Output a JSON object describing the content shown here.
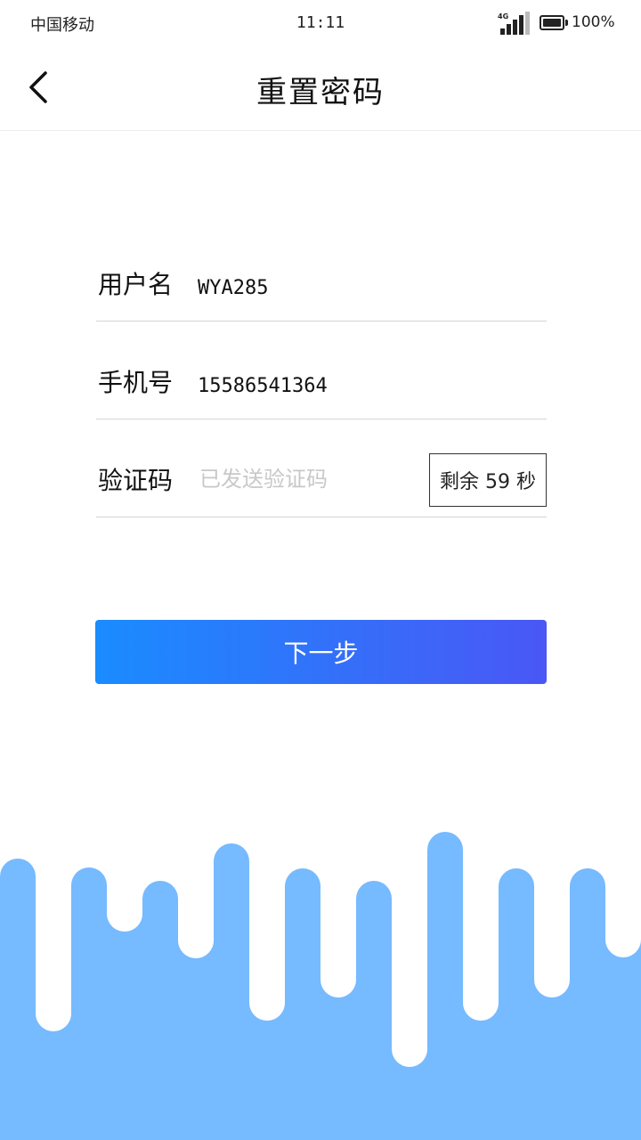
{
  "status": {
    "carrier": "中国移动",
    "time": "11:11",
    "network": "4G",
    "battery": "100%"
  },
  "nav": {
    "back_icon": "chevron-left-icon",
    "title": "重置密码"
  },
  "form": {
    "username_label": "用户名",
    "username_value": "WYA285",
    "phone_label": "手机号",
    "phone_value": "15586541364",
    "code_label": "验证码",
    "code_placeholder": "已发送验证码",
    "countdown": "剩余 59 秒"
  },
  "actions": {
    "next_label": "下一步"
  },
  "colors": {
    "button_start": "#1a8cff",
    "button_end": "#4a57f5",
    "drip": "#76baff"
  }
}
